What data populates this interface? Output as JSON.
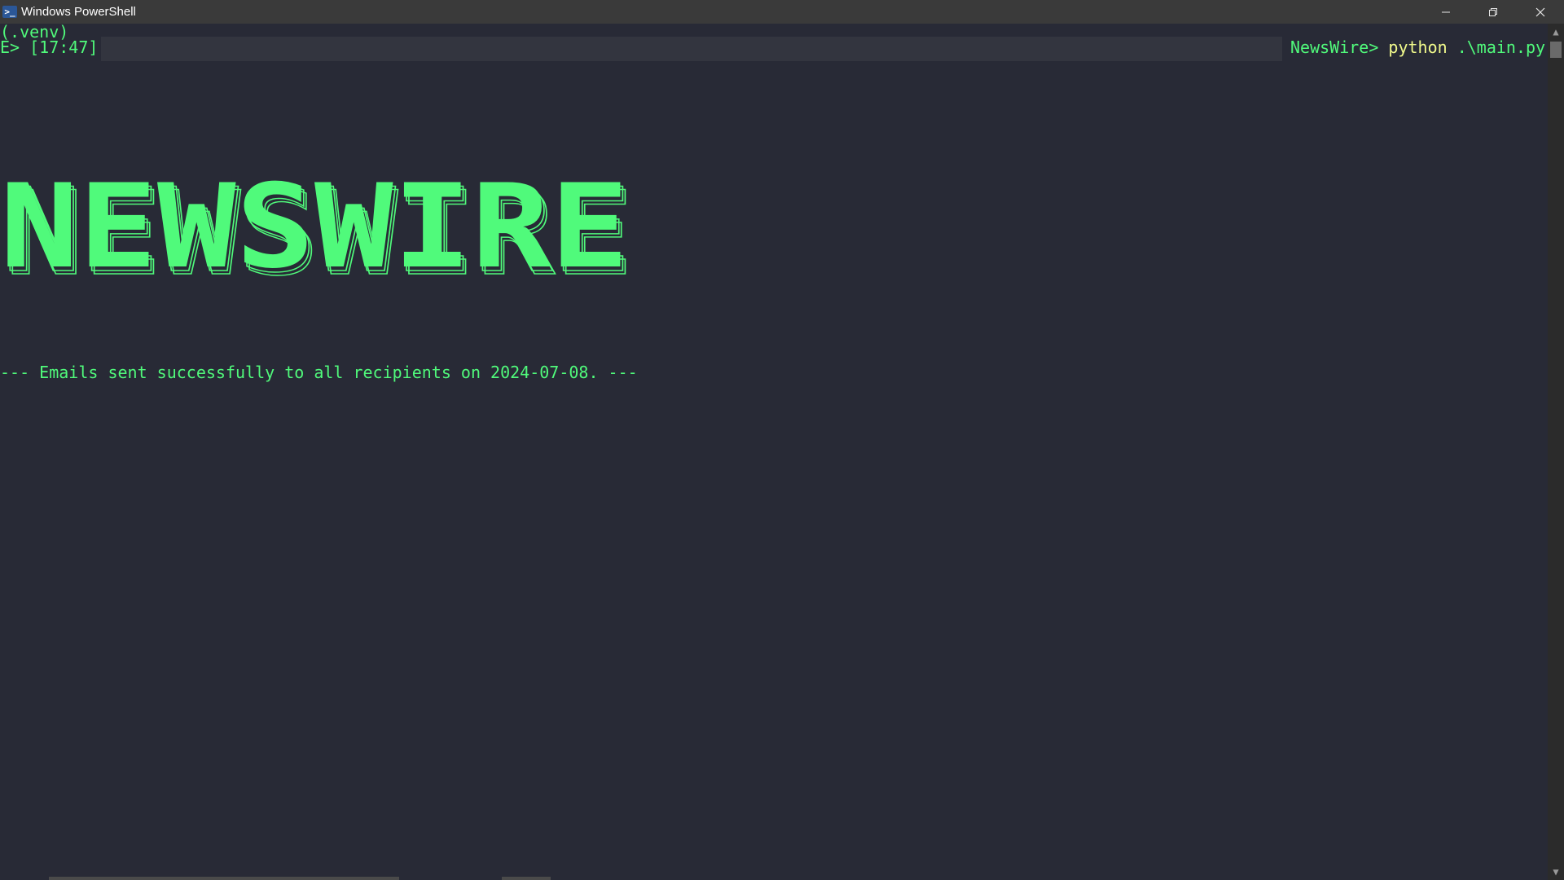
{
  "window": {
    "title": "Windows PowerShell",
    "icon": "powershell-icon",
    "controls": {
      "minimize": "minimize-icon",
      "restore": "restore-icon",
      "close": "close-icon"
    }
  },
  "terminal": {
    "venv_line": "(.venv)",
    "prompt_left": "E> [17:47]",
    "prompt_dir": "NewsWire> ",
    "command": "python",
    "command_arg": " .\\main.py",
    "banner": "NEWSWIRE",
    "status_message": "--- Emails sent successfully to all recipients on 2024-07-08. ---"
  },
  "colors": {
    "background": "#282a36",
    "text_green": "#50fa7b",
    "command_yellow": "#f1fa8c"
  }
}
